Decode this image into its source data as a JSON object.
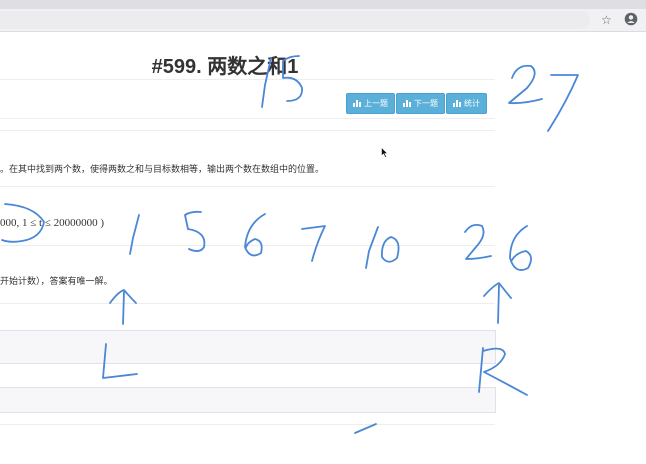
{
  "problem": {
    "title": "#599. 两数之和1",
    "description_fragment": "。在其中找到两个数，使得两数之和与目标数相等，输出两个数在数组中的位置。",
    "constraint_fragment": "000, 1 ≤ t ≤ 20000000 )",
    "note_fragment": "开始计数），答案有唯一解。"
  },
  "toolbar": {
    "buttons": [
      {
        "label": "上一题",
        "icon": "bar-chart-icon"
      },
      {
        "label": "下一题",
        "icon": "bar-chart-icon"
      },
      {
        "label": "统计",
        "icon": "bar-chart-icon"
      }
    ]
  },
  "browser": {
    "icons": [
      "star-icon",
      "account-icon"
    ]
  },
  "annotations": {
    "color": "#4a87d6",
    "numbers": [
      "15",
      "27",
      "1",
      "5",
      "6",
      "7",
      "10",
      "26"
    ],
    "pointer_labels": [
      "L",
      "R"
    ]
  }
}
